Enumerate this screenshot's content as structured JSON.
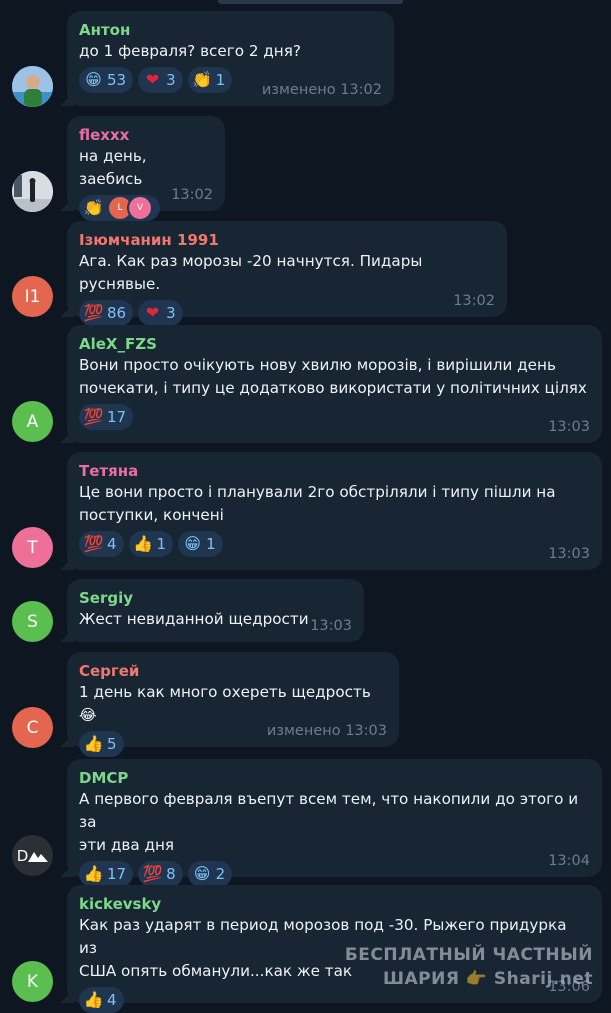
{
  "messages": [
    {
      "author": "Антон",
      "author_color": "#7dd98a",
      "text": "до 1 февраля? всего 2 дня?",
      "time": "изменено 13:02",
      "avatar": {
        "kind": "photo",
        "letter": "",
        "color": "#6aa0d8"
      },
      "reactions": [
        {
          "icon": "grin-emoji-icon",
          "glyph": "😁",
          "count": "53"
        },
        {
          "icon": "heart-emoji-icon",
          "glyph": "❤",
          "count": "3"
        },
        {
          "icon": "clap-emoji-icon",
          "glyph": "👏",
          "count": "1"
        }
      ]
    },
    {
      "author": "flexxx",
      "author_color": "#ea6fa2",
      "text": "на день, заебись",
      "time": "13:02",
      "avatar": {
        "kind": "photo",
        "letter": "",
        "color": "#c5ccd4"
      },
      "reactions": [
        {
          "icon": "clap-emoji-icon",
          "glyph": "👏",
          "count": "",
          "users": [
            "L",
            "V"
          ]
        }
      ]
    },
    {
      "author": "Ізюмчанин 1991",
      "author_color": "#f0786e",
      "text": "Ага. Как раз морозы -20 начнутся. Пидары руснявые.",
      "time": "13:02",
      "avatar": {
        "kind": "letter",
        "letter": "І1",
        "color": "#e5664f"
      },
      "reactions": [
        {
          "icon": "hundred-emoji-icon",
          "glyph": "💯",
          "count": "86"
        },
        {
          "icon": "heart-emoji-icon",
          "glyph": "❤",
          "count": "3"
        }
      ]
    },
    {
      "author": "AleX_FZS",
      "author_color": "#7dd98a",
      "text": "Вони просто очікують нову хвилю морозів, і вирішили день\nпочекати, і типу це додатково використати у політичних цілях",
      "time": "13:03",
      "avatar": {
        "kind": "letter",
        "letter": "A",
        "color": "#5bbf50"
      },
      "reactions": [
        {
          "icon": "hundred-emoji-icon",
          "glyph": "💯",
          "count": "17"
        }
      ]
    },
    {
      "author": "Тетяна",
      "author_color": "#ea6fa2",
      "text": "Це вони просто і планували 2го обстріляли і типу пішли на\nпоступки, кончені",
      "time": "13:03",
      "avatar": {
        "kind": "letter",
        "letter": "Т",
        "color": "#ee6f98"
      },
      "reactions": [
        {
          "icon": "hundred-emoji-icon",
          "glyph": "💯",
          "count": "4"
        },
        {
          "icon": "thumbs-up-emoji-icon",
          "glyph": "👍",
          "count": "1"
        },
        {
          "icon": "grin-emoji-icon",
          "glyph": "😁",
          "count": "1"
        }
      ]
    },
    {
      "author": "Sergiy",
      "author_color": "#7dd98a",
      "text": "Жест невиданной щедрости",
      "time": "13:03",
      "avatar": {
        "kind": "letter",
        "letter": "S",
        "color": "#5bbf50"
      },
      "reactions": []
    },
    {
      "author": "Сергей",
      "author_color": "#f0786e",
      "text": "1 день как много охереть щедрость 😂",
      "time": "изменено 13:03",
      "avatar": {
        "kind": "letter",
        "letter": "С",
        "color": "#e5664f"
      },
      "reactions": [
        {
          "icon": "thumbs-up-emoji-icon",
          "glyph": "👍",
          "count": "5"
        }
      ]
    },
    {
      "author": "DMCP",
      "author_color": "#7dd98a",
      "text": "А первого февраля въепут всем тем, что накопили до этого и за\nэти два дня",
      "time": "13:04",
      "avatar": {
        "kind": "logo",
        "letter": "D",
        "color": "#2b2f36"
      },
      "reactions": [
        {
          "icon": "thumbs-up-emoji-icon",
          "glyph": "👍",
          "count": "17"
        },
        {
          "icon": "hundred-emoji-icon",
          "glyph": "💯",
          "count": "8"
        },
        {
          "icon": "grin-emoji-icon",
          "glyph": "😁",
          "count": "2"
        }
      ]
    },
    {
      "author": "kickevsky",
      "author_color": "#7dd98a",
      "text": "Как раз ударят в период морозов под -30. Рыжего придурка из\nСША опять обманули...как же так",
      "time": "13:06",
      "avatar": {
        "kind": "letter",
        "letter": "K",
        "color": "#5bbf50"
      },
      "reactions": [
        {
          "icon": "thumbs-up-emoji-icon",
          "glyph": "👍",
          "count": "4"
        }
      ]
    }
  ],
  "watermark": {
    "line1": "БЕСПЛАТНЫЙ ЧАСТНЫЙ",
    "line2": "ШАРИЯ 👉 Sharij.net"
  }
}
